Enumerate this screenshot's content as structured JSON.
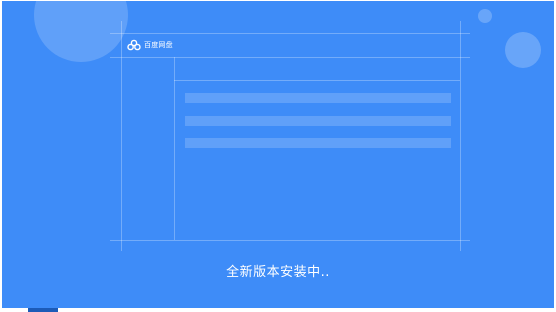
{
  "app": {
    "brand_name": "百度网盘",
    "brand_icon": "cloud-logo-icon",
    "status_text": "全新版本安装中.."
  },
  "colors": {
    "background": "#3e8cf8",
    "text": "#ffffff"
  }
}
